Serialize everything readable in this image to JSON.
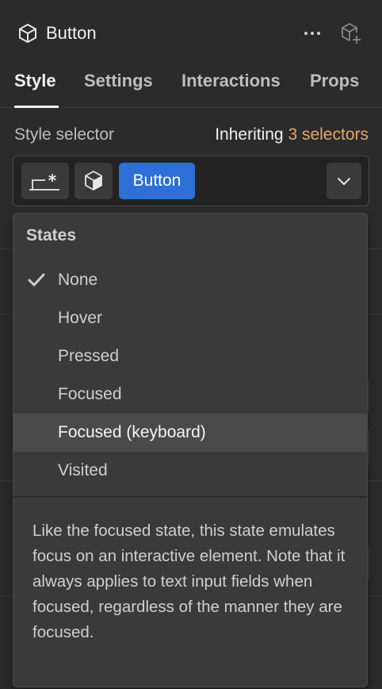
{
  "header": {
    "title": "Button",
    "cube_icon": "cube-icon",
    "more_icon": "more-horizontal-icon",
    "add_component_icon": "add-component-icon"
  },
  "tabs": [
    {
      "label": "Style",
      "active": true
    },
    {
      "label": "Settings",
      "active": false
    },
    {
      "label": "Interactions",
      "active": false
    },
    {
      "label": "Props",
      "active": false
    }
  ],
  "style_selector": {
    "label": "Style selector",
    "inheriting_prefix": "Inheriting",
    "inheriting_count": "3 selectors",
    "chips": [
      {
        "icon": "global-tag-icon"
      },
      {
        "icon": "component-cube-icon"
      },
      {
        "label": "Button",
        "active": true
      }
    ],
    "dropdown_icon": "chevron-down-icon"
  },
  "states_menu": {
    "title": "States",
    "items": [
      {
        "label": "None",
        "checked": true
      },
      {
        "label": "Hover",
        "checked": false
      },
      {
        "label": "Pressed",
        "checked": false
      },
      {
        "label": "Focused",
        "checked": false
      },
      {
        "label": "Focused (keyboard)",
        "checked": false,
        "highlighted": true
      },
      {
        "label": "Visited",
        "checked": false
      }
    ],
    "description": "Like the focused state, this state emulates focus on an interactive element. Note that it always applies to text input fields when focused, regardless of the manner they are focused."
  },
  "colors": {
    "accent": "#e6a66b",
    "selected_chip": "#2d6fd6",
    "background": "#2b2b2b"
  }
}
